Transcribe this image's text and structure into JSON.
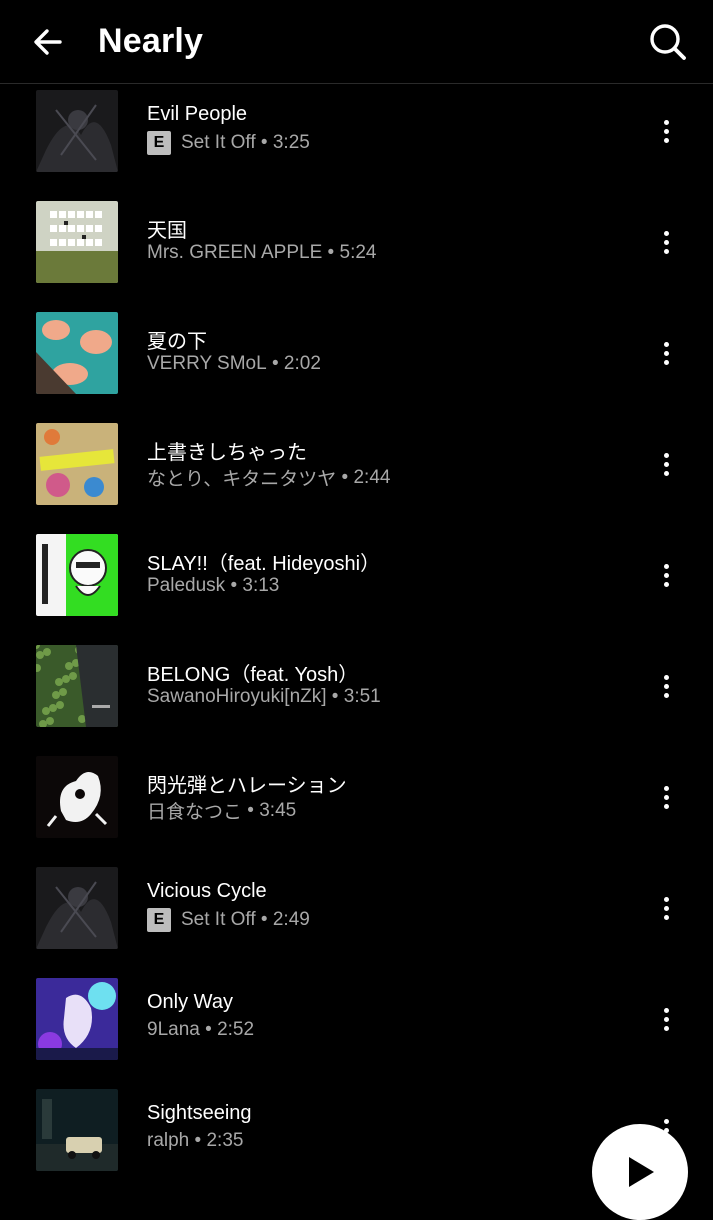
{
  "header": {
    "title": "Nearly",
    "back_icon": "arrow-left-icon",
    "search_icon": "search-icon"
  },
  "songs": [
    {
      "title": "Evil People",
      "explicit": true,
      "artist": "Set It Off",
      "duration": "3:25"
    },
    {
      "title": "天国",
      "explicit": false,
      "artist": "Mrs. GREEN APPLE",
      "duration": "5:24"
    },
    {
      "title": "夏の下",
      "explicit": false,
      "artist": "VERRY SMoL",
      "duration": "2:02"
    },
    {
      "title": "上書きしちゃった",
      "explicit": false,
      "artist": "なとり、キタニタツヤ",
      "duration": "2:44"
    },
    {
      "title": "SLAY!!（feat. Hideyoshi）",
      "explicit": false,
      "artist": "Paledusk",
      "duration": "3:13"
    },
    {
      "title": "BELONG（feat. Yosh）",
      "explicit": false,
      "artist": "SawanoHiroyuki[nZk]",
      "duration": "3:51"
    },
    {
      "title": "閃光弾とハレーション",
      "explicit": false,
      "artist": "日食なつこ",
      "duration": "3:45"
    },
    {
      "title": "Vicious Cycle",
      "explicit": true,
      "artist": "Set It Off",
      "duration": "2:49"
    },
    {
      "title": "Only Way",
      "explicit": false,
      "artist": "9Lana",
      "duration": "2:52"
    },
    {
      "title": "Sightseeing",
      "explicit": false,
      "artist": "ralph",
      "duration": "2:35"
    }
  ],
  "explicit_badge": "E",
  "separator": " • ",
  "colors": {
    "background": "#000000",
    "text": "#ffffff",
    "secondary_text": "#a8a8a8",
    "badge": "#bdbdbd"
  },
  "play_button_icon": "play-icon"
}
